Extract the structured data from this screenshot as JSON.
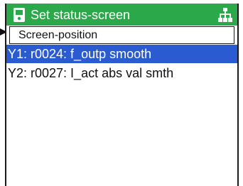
{
  "window": {
    "title": "Set status-screen",
    "title_icon": "device-icon",
    "hierarchy_icon": "hierarchy-icon"
  },
  "subheader": {
    "label": "Screen-position"
  },
  "rows": [
    {
      "label": "Y1: r0024:  f_outp smooth",
      "selected": true
    },
    {
      "label": "Y2: r0027:  I_act abs val smth",
      "selected": false
    }
  ],
  "colors": {
    "title_bar": "#2aa84a",
    "selection": "#2a5bd1",
    "text": "#111111",
    "title_text": "#ffffff"
  }
}
